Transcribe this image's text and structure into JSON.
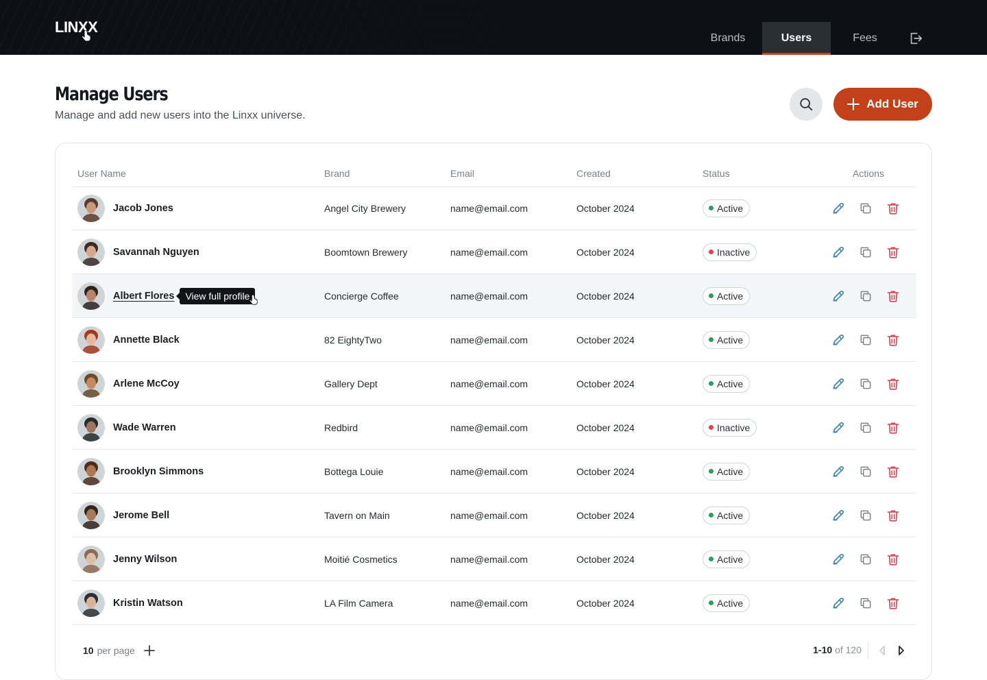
{
  "app": {
    "logo_text": "LINXX",
    "nav": [
      {
        "label": "Brands",
        "active": false
      },
      {
        "label": "Users",
        "active": true
      },
      {
        "label": "Fees",
        "active": false
      }
    ]
  },
  "page": {
    "title": "Manage Users",
    "subtitle": "Manage and add new users into the Linxx universe.",
    "add_button_label": "Add User"
  },
  "table": {
    "columns": [
      "User Name",
      "Brand",
      "Email",
      "Created",
      "Status",
      "Actions"
    ],
    "rows": [
      {
        "name": "Jacob Jones",
        "brand": "Angel City Brewery",
        "email": "name@email.com",
        "created": "October 2024",
        "status": "Active"
      },
      {
        "name": "Savannah Nguyen",
        "brand": "Boomtown Brewery",
        "email": "name@email.com",
        "created": "October 2024",
        "status": "Inactive"
      },
      {
        "name": "Albert Flores",
        "brand": "Concierge Coffee",
        "email": "name@email.com",
        "created": "October 2024",
        "status": "Active"
      },
      {
        "name": "Annette Black",
        "brand": "82 EightyTwo",
        "email": "name@email.com",
        "created": "October 2024",
        "status": "Active"
      },
      {
        "name": "Arlene McCoy",
        "brand": "Gallery Dept",
        "email": "name@email.com",
        "created": "October 2024",
        "status": "Active"
      },
      {
        "name": "Wade Warren",
        "brand": "Redbird",
        "email": "name@email.com",
        "created": "October 2024",
        "status": "Inactive"
      },
      {
        "name": "Brooklyn Simmons",
        "brand": "Bottega Louie",
        "email": "name@email.com",
        "created": "October 2024",
        "status": "Active"
      },
      {
        "name": "Jerome Bell",
        "brand": "Tavern on Main",
        "email": "name@email.com",
        "created": "October 2024",
        "status": "Active"
      },
      {
        "name": "Jenny Wilson",
        "brand": "Moitié Cosmetics",
        "email": "name@email.com",
        "created": "October 2024",
        "status": "Active"
      },
      {
        "name": "Kristin Watson",
        "brand": "LA Film Camera",
        "email": "name@email.com",
        "created": "October 2024",
        "status": "Active"
      }
    ],
    "hovered_row": 2,
    "tooltip": "View full profile"
  },
  "pagination": {
    "per_page_value": "10",
    "per_page_label": "per page",
    "range": "1-10",
    "of_total": "of 120"
  },
  "colors": {
    "header_bg": "#0d1117",
    "accent": "#c2411a",
    "active_dot": "#2e9e5b",
    "inactive_dot": "#e0424f",
    "edit_icon": "#3a89a8",
    "delete_icon": "#d9434f"
  },
  "icons": {
    "search": "search-icon",
    "add": "plus-icon",
    "logout": "logout-icon",
    "edit": "pencil-icon",
    "copy": "copy-icon",
    "delete": "trash-icon"
  }
}
